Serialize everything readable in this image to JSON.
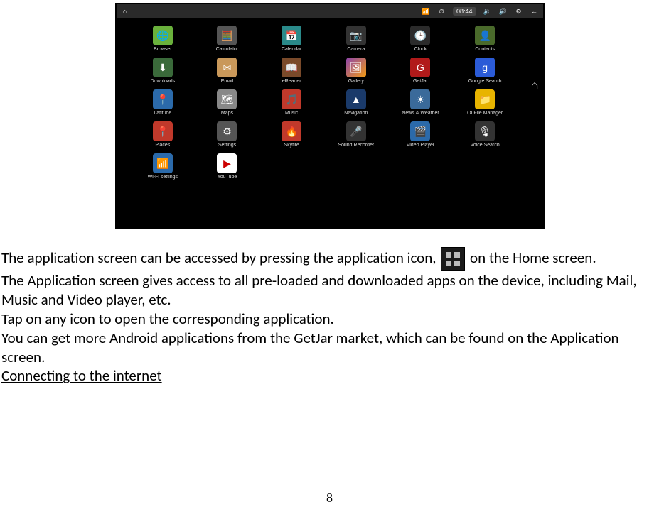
{
  "status_bar": {
    "time": "08:44",
    "icons": [
      "home-icon",
      "wifi-icon",
      "clock-icon",
      "volume-down-icon",
      "volume-up-icon",
      "settings-icon",
      "back-icon"
    ]
  },
  "apps": [
    {
      "label": "Browser",
      "cls": "ic-green",
      "glyph": "🌐"
    },
    {
      "label": "Calculator",
      "cls": "ic-grey",
      "glyph": "🧮"
    },
    {
      "label": "Calendar",
      "cls": "ic-teal",
      "glyph": "📅"
    },
    {
      "label": "Camera",
      "cls": "ic-camera",
      "glyph": "📷"
    },
    {
      "label": "Clock",
      "cls": "ic-clock",
      "glyph": "🕒"
    },
    {
      "label": "Contacts",
      "cls": "ic-contacts",
      "glyph": "👤"
    },
    {
      "label": "Downloads",
      "cls": "ic-dl",
      "glyph": "⬇"
    },
    {
      "label": "Email",
      "cls": "ic-mail",
      "glyph": "✉"
    },
    {
      "label": "eReader",
      "cls": "ic-ereader",
      "glyph": "📖"
    },
    {
      "label": "Gallery",
      "cls": "ic-gallery",
      "glyph": "🖼"
    },
    {
      "label": "GetJar",
      "cls": "ic-getjar",
      "glyph": "G"
    },
    {
      "label": "Google Search",
      "cls": "ic-google",
      "glyph": "g"
    },
    {
      "label": "Latitude",
      "cls": "ic-lat",
      "glyph": "📍"
    },
    {
      "label": "Maps",
      "cls": "ic-maps",
      "glyph": "🗺"
    },
    {
      "label": "Music",
      "cls": "ic-music",
      "glyph": "🎵"
    },
    {
      "label": "Navigation",
      "cls": "ic-nav",
      "glyph": "▲"
    },
    {
      "label": "News & Weather",
      "cls": "ic-news",
      "glyph": "☀"
    },
    {
      "label": "OI File Manager",
      "cls": "ic-folder",
      "glyph": "📁"
    },
    {
      "label": "Places",
      "cls": "ic-places",
      "glyph": "📍"
    },
    {
      "label": "Settings",
      "cls": "ic-settings",
      "glyph": "⚙"
    },
    {
      "label": "Skyfire",
      "cls": "ic-skyfire",
      "glyph": "🔥"
    },
    {
      "label": "Sound Recorder",
      "cls": "ic-rec",
      "glyph": "🎤"
    },
    {
      "label": "Video Player",
      "cls": "ic-video",
      "glyph": "🎬"
    },
    {
      "label": "Voice Search",
      "cls": "ic-voice",
      "glyph": "🎙"
    },
    {
      "label": "Wi-Fi settings",
      "cls": "ic-wifi",
      "glyph": "📶"
    },
    {
      "label": "YouTube",
      "cls": "ic-youtube",
      "glyph": "▶"
    }
  ],
  "side_home_glyph": "⌂",
  "body": {
    "p1a": "The application screen can be accessed by pressing the application icon, ",
    "p1b": " on the Home screen.",
    "p2": "The Application screen gives access to all pre-loaded and downloaded apps on the device, including Mail, Music and Video player, etc.",
    "p3": "Tap on any icon to open the corresponding application.",
    "p4": "You can get more Android applications from the GetJar market, which can be found on the Application screen.",
    "heading": "Connecting to the internet"
  },
  "page_number": "8"
}
